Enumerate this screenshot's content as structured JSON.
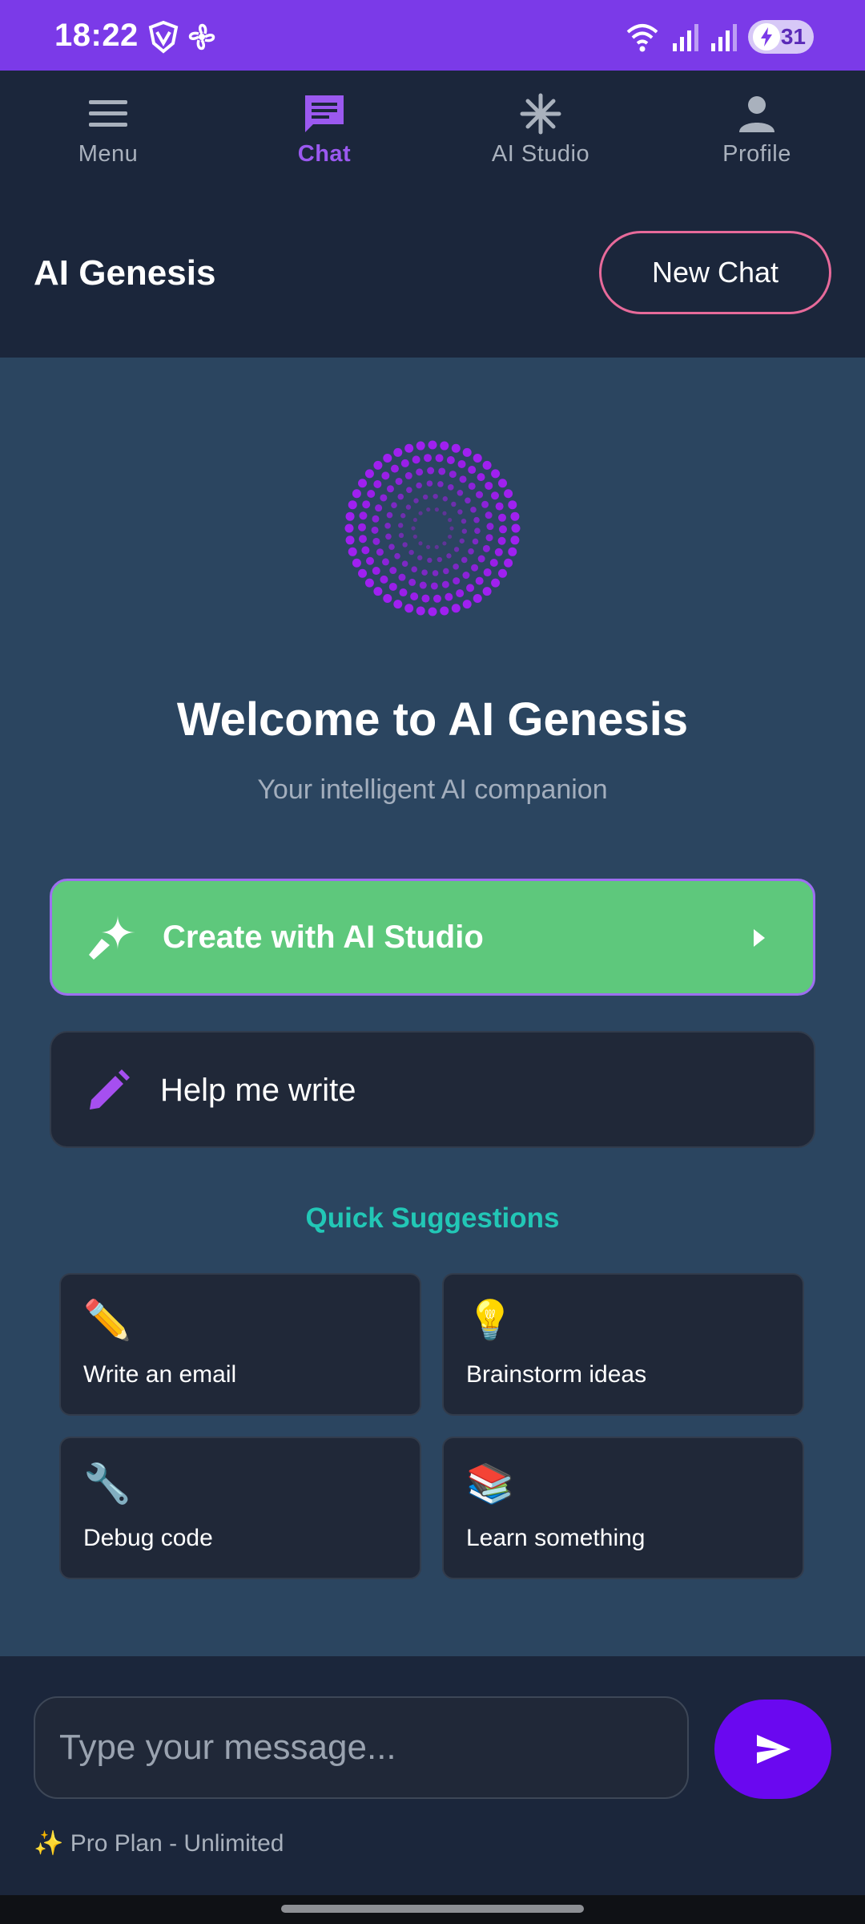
{
  "status_bar": {
    "time": "18:22",
    "battery_level": "31",
    "icons": [
      "vpn-shield-icon",
      "pinwheel-icon",
      "wifi-icon",
      "signal-icon",
      "signal-icon",
      "battery-charging-icon"
    ]
  },
  "nav": {
    "items": [
      {
        "label": "Menu",
        "icon": "menu-icon",
        "active": false
      },
      {
        "label": "Chat",
        "icon": "chat-icon",
        "active": true
      },
      {
        "label": "AI Studio",
        "icon": "asterisk-icon",
        "active": false
      },
      {
        "label": "Profile",
        "icon": "person-icon",
        "active": false
      }
    ]
  },
  "header": {
    "title": "AI Genesis",
    "new_chat_label": "New Chat"
  },
  "welcome": {
    "title": "Welcome to AI Genesis",
    "subtitle": "Your intelligent AI companion"
  },
  "actions": {
    "studio_label": "Create with AI Studio",
    "write_label": "Help me write"
  },
  "quick_suggestions": {
    "title": "Quick Suggestions",
    "items": [
      {
        "emoji": "✏️",
        "label": "Write an email"
      },
      {
        "emoji": "💡",
        "label": "Brainstorm ideas"
      },
      {
        "emoji": "🔧",
        "label": "Debug code"
      },
      {
        "emoji": "📚",
        "label": "Learn something"
      }
    ]
  },
  "composer": {
    "placeholder": "Type your message...",
    "plan_text": "✨ Pro Plan - Unlimited"
  },
  "colors": {
    "status_bar": "#7b3ae8",
    "nav_bg": "#1b263b",
    "main_bg": "#2b4560",
    "accent_purple": "#9b59f0",
    "studio_green": "#5ec87c",
    "teal": "#22c7b6",
    "send_button": "#6a08f0",
    "new_chat_border": "#e76a9a"
  }
}
